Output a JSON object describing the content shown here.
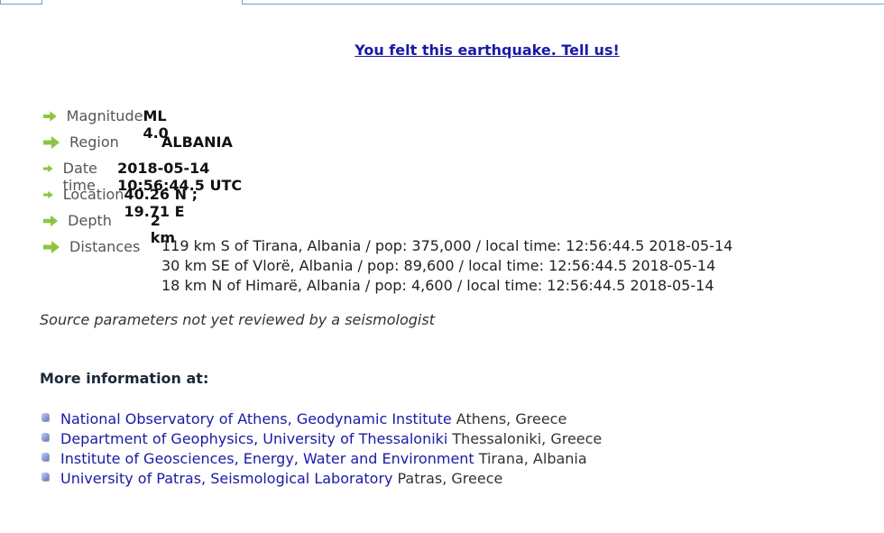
{
  "felt_link": "You felt this earthquake. Tell us!",
  "details": {
    "magnitude": {
      "label": "Magnitude",
      "value": "ML 4.0"
    },
    "region": {
      "label": "Region",
      "value": "ALBANIA"
    },
    "datetime": {
      "label": "Date time",
      "value": "2018-05-14 10:56:44.5 UTC"
    },
    "location": {
      "label": "Location",
      "value": "40.26 N ; 19.71 E"
    },
    "depth": {
      "label": "Depth",
      "value": "2 km"
    },
    "distances": {
      "label": "Distances",
      "lines": [
        "119 km S of Tirana, Albania / pop: 375,000 / local time: 12:56:44.5 2018-05-14",
        "30 km SE of Vlorë, Albania / pop: 89,600 / local time: 12:56:44.5 2018-05-14",
        "18 km N of Himarë, Albania / pop: 4,600 / local time: 12:56:44.5 2018-05-14"
      ]
    }
  },
  "source_note": "Source parameters not yet reviewed by a seismologist",
  "more_info": {
    "title": "More information at:",
    "links": [
      {
        "name": "National Observatory of Athens, Geodynamic Institute",
        "location": "Athens, Greece"
      },
      {
        "name": "Department of Geophysics, University of Thessaloniki",
        "location": "Thessaloniki, Greece"
      },
      {
        "name": "Institute of Geosciences, Energy, Water and Environment",
        "location": "Tirana, Albania"
      },
      {
        "name": "University of Patras, Seismological Laboratory",
        "location": "Patras, Greece"
      }
    ]
  },
  "colors": {
    "link": "#1a1aa6",
    "arrow": "#8cc63f"
  },
  "icons": {
    "row_arrow": "green-right-arrow-icon",
    "link_bullet": "blue-bullet-icon"
  }
}
